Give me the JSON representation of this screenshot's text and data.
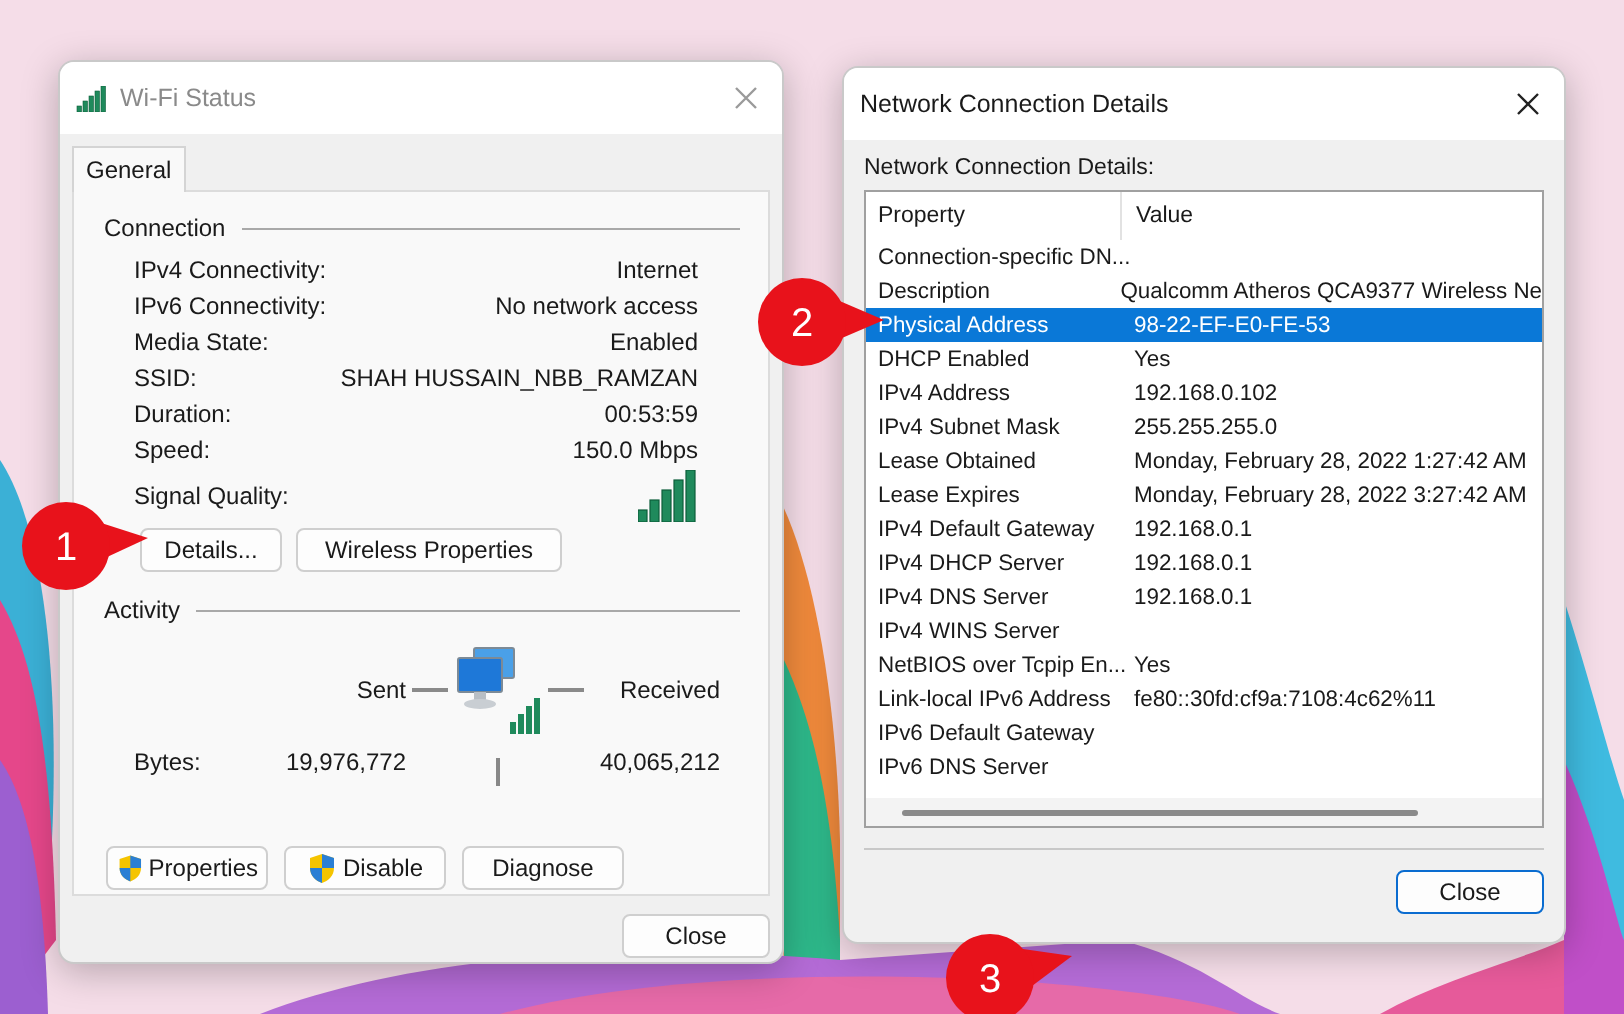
{
  "wifi_status": {
    "title": "Wi-Fi Status",
    "tabs": [
      {
        "label": "General",
        "selected": true
      }
    ],
    "connection": {
      "heading": "Connection",
      "rows": [
        {
          "label": "IPv4 Connectivity:",
          "value": "Internet"
        },
        {
          "label": "IPv6 Connectivity:",
          "value": "No network access"
        },
        {
          "label": "Media State:",
          "value": "Enabled"
        },
        {
          "label": "SSID:",
          "value": "SHAH HUSSAIN_NBB_RAMZAN"
        },
        {
          "label": "Duration:",
          "value": "00:53:59"
        },
        {
          "label": "Speed:",
          "value": "150.0 Mbps"
        }
      ],
      "signal_label": "Signal Quality:"
    },
    "connection_buttons": [
      "Details...",
      "Wireless Properties"
    ],
    "activity": {
      "heading": "Activity",
      "sent_label": "Sent",
      "received_label": "Received",
      "bytes_label": "Bytes:",
      "sent": "19,976,772",
      "received": "40,065,212"
    },
    "action_buttons": [
      {
        "label": "Properties",
        "shield": true
      },
      {
        "label": "Disable",
        "shield": true
      },
      {
        "label": "Diagnose",
        "shield": false
      }
    ],
    "close_button": "Close"
  },
  "details": {
    "title": "Network Connection Details",
    "caption": "Network Connection Details:",
    "columns": [
      "Property",
      "Value"
    ],
    "rows": [
      {
        "property": "Connection-specific DN...",
        "selected": false
      },
      {
        "property": "Description",
        "value": "Qualcomm Atheros QCA9377 Wireless Ne",
        "selected": false
      },
      {
        "property": "Physical Address",
        "value": "98-22-EF-E0-FE-53",
        "selected": true
      },
      {
        "property": "DHCP Enabled",
        "value": "Yes",
        "selected": false
      },
      {
        "property": "IPv4 Address",
        "value": "192.168.0.102",
        "selected": false
      },
      {
        "property": "IPv4 Subnet Mask",
        "value": "255.255.255.0",
        "selected": false
      },
      {
        "property": "Lease Obtained",
        "value": "Monday, February 28, 2022 1:27:42 AM",
        "selected": false
      },
      {
        "property": "Lease Expires",
        "value": "Monday, February 28, 2022 3:27:42 AM",
        "selected": false
      },
      {
        "property": "IPv4 Default Gateway",
        "value": "192.168.0.1",
        "selected": false
      },
      {
        "property": "IPv4 DHCP Server",
        "value": "192.168.0.1",
        "selected": false
      },
      {
        "property": "IPv4 DNS Server",
        "value": "192.168.0.1",
        "selected": false
      },
      {
        "property": "IPv4 WINS Server",
        "selected": false
      },
      {
        "property": "NetBIOS over Tcpip En...",
        "value": "Yes",
        "selected": false
      },
      {
        "property": "Link-local IPv6 Address",
        "value": "fe80::30fd:cf9a:7108:4c62%11",
        "selected": false
      },
      {
        "property": "IPv6 Default Gateway",
        "selected": false
      },
      {
        "property": "IPv6 DNS Server",
        "selected": false
      }
    ],
    "close_button": "Close"
  },
  "callouts": [
    "1",
    "2",
    "3"
  ]
}
